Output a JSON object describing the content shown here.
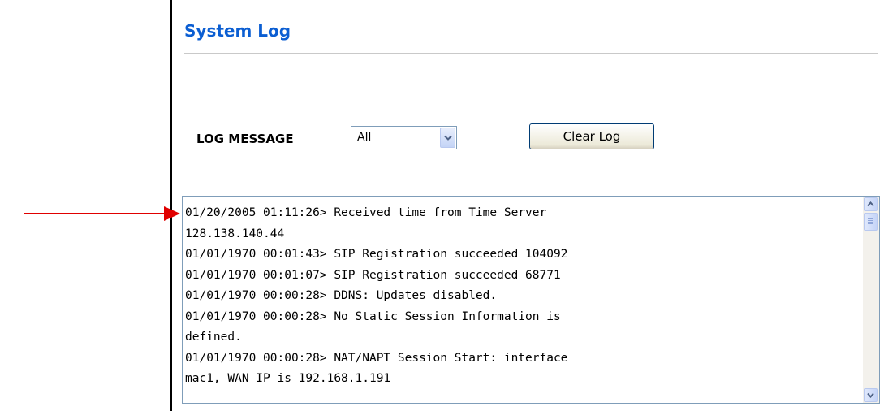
{
  "page": {
    "title": "System Log",
    "title_color": "#0b5ed2"
  },
  "filter": {
    "label": "LOG MESSAGE",
    "selected": "All"
  },
  "actions": {
    "clear_label": "Clear Log"
  },
  "log": {
    "lines": [
      "01/20/2005 01:11:26> Received time from Time Server",
      "128.138.140.44",
      "01/01/1970 00:01:43> SIP Registration succeeded 104092",
      "01/01/1970 00:01:07> SIP Registration succeeded 68771",
      "01/01/1970 00:00:28> DDNS: Updates disabled.",
      "01/01/1970 00:00:28> No Static Session Information is",
      "defined.",
      "01/01/1970 00:00:28> NAT/NAPT Session Start: interface",
      "mac1, WAN IP is 192.168.1.191"
    ]
  },
  "annotation": {
    "arrow_color": "#e00000",
    "icon": "pointer-arrow-icon"
  },
  "icons": {
    "dropdown": "chevron-down-icon",
    "scroll_up": "scroll-up-icon",
    "scroll_down": "scroll-down-icon"
  }
}
